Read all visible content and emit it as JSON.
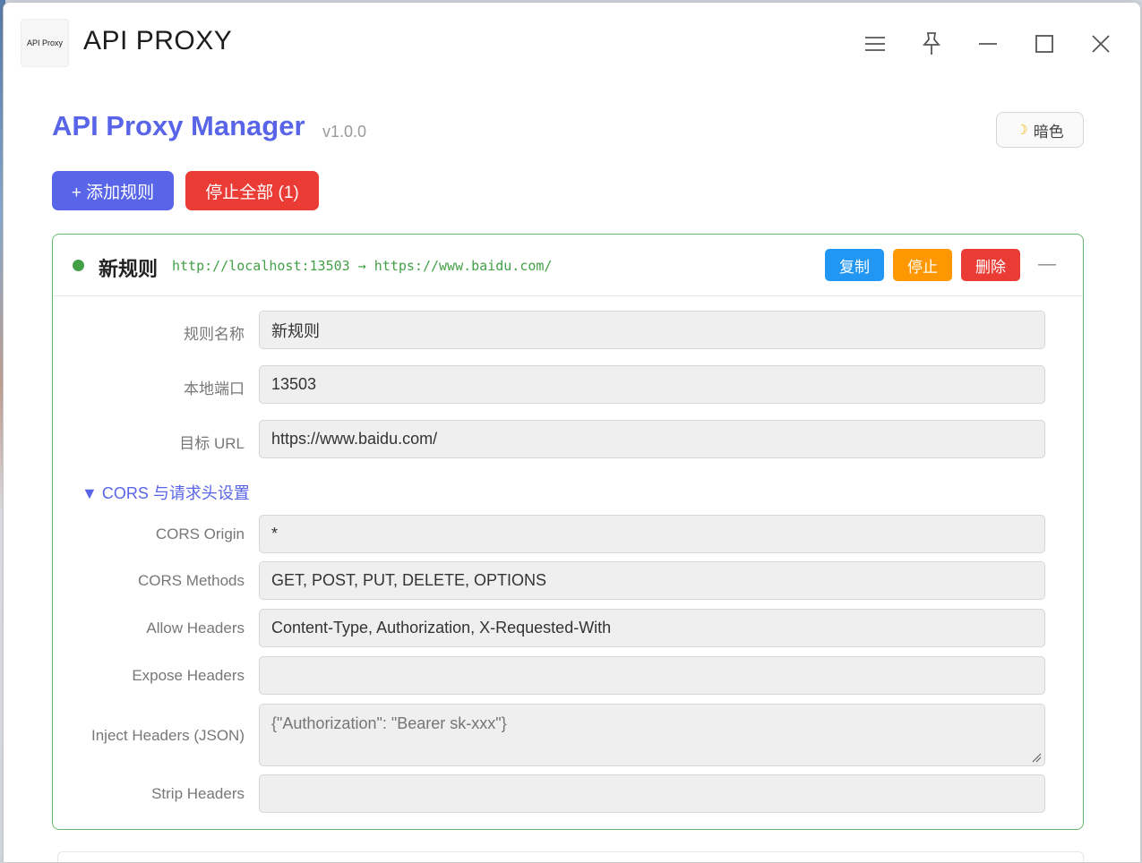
{
  "window": {
    "logo_text": "API Proxy",
    "title": "API PROXY"
  },
  "header": {
    "heading": "API Proxy Manager",
    "version": "v1.0.0",
    "theme_label": "暗色",
    "theme_icon": "moon-icon"
  },
  "toolbar": {
    "add_label": "+ 添加规则",
    "stop_all_label": "停止全部 (1)"
  },
  "colors": {
    "accent": "#5865e8",
    "danger": "#ea3b35",
    "copy": "#2196f3",
    "stop": "#ff9800",
    "running": "#43a047"
  },
  "rule": {
    "status": "running",
    "name": "新规则",
    "route": "http://localhost:13503 → https://www.baidu.com/",
    "copy_label": "复制",
    "stop_label": "停止",
    "delete_label": "删除",
    "collapse_label": "—",
    "fields": {
      "name": {
        "label": "规则名称",
        "value": "新规则"
      },
      "port": {
        "label": "本地端口",
        "value": "13503"
      },
      "target": {
        "label": "目标 URL",
        "value": "https://www.baidu.com/"
      }
    },
    "cors_section": "▼ CORS 与请求头设置",
    "cors": {
      "origin": {
        "label": "CORS Origin",
        "value": "*"
      },
      "methods": {
        "label": "CORS Methods",
        "value": "GET, POST, PUT, DELETE, OPTIONS"
      },
      "allow_headers": {
        "label": "Allow Headers",
        "value": "Content-Type, Authorization, X-Requested-With"
      },
      "expose_headers": {
        "label": "Expose Headers",
        "value": ""
      },
      "inject_headers": {
        "label": "Inject Headers (JSON)",
        "placeholder": "{\"Authorization\": \"Bearer sk-xxx\"}"
      },
      "strip_headers": {
        "label": "Strip Headers",
        "value": ""
      }
    }
  }
}
